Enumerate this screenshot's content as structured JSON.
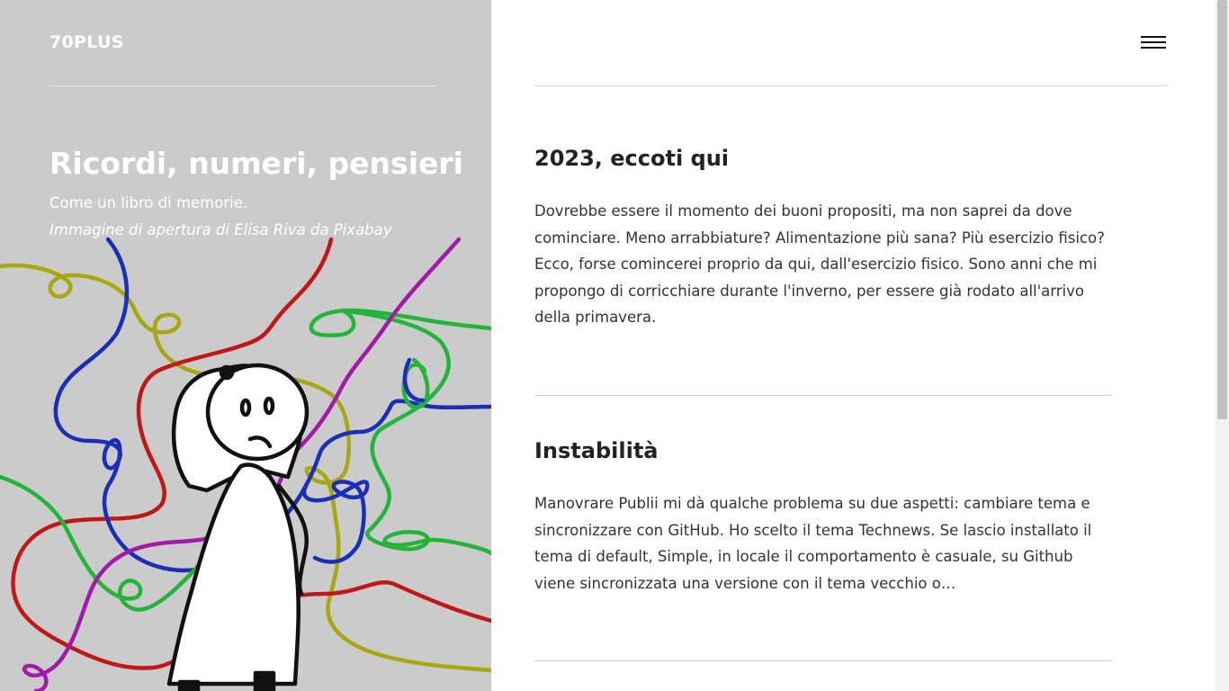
{
  "site": {
    "name": "70PLUS"
  },
  "hero": {
    "heading": "Ricordi, numeri, pensieri",
    "subtitle": "Come un libro di memorie.",
    "credit": "Immagine di apertura di Elisa Riva da Pixabay"
  },
  "header": {
    "menu_icon": "hamburger-menu-icon"
  },
  "posts": [
    {
      "title": "2023, eccoti qui",
      "excerpt": "Dovrebbe essere il momento dei buoni propositi, ma non saprei da dove cominciare. Meno arrabbiature? Alimentazione più sana? Più esercizio fisico? Ecco, forse comincerei proprio da qui, dall'esercizio fisico. Sono anni che mi propongo di corricchiare durante l'inverno, per essere già rodato all'arrivo della primavera."
    },
    {
      "title": "Instabilità",
      "excerpt": "Manovrare Publii mi dà qualche problema su due aspetti: cambiare tema e sincronizzare con GitHub. Ho scelto il tema Technews. Se lascio installato il tema di default, Simple, in locale il comportamento è casuale, su Github viene sincronizzata una versione con il tema vecchio o…"
    }
  ],
  "colors": {
    "hero_background": "#cbcbcb",
    "line_blue": "#1a2fb8",
    "line_green": "#22b53a",
    "line_red": "#c01818",
    "line_yellow": "#a9a70e",
    "line_purple": "#a21aa8"
  }
}
